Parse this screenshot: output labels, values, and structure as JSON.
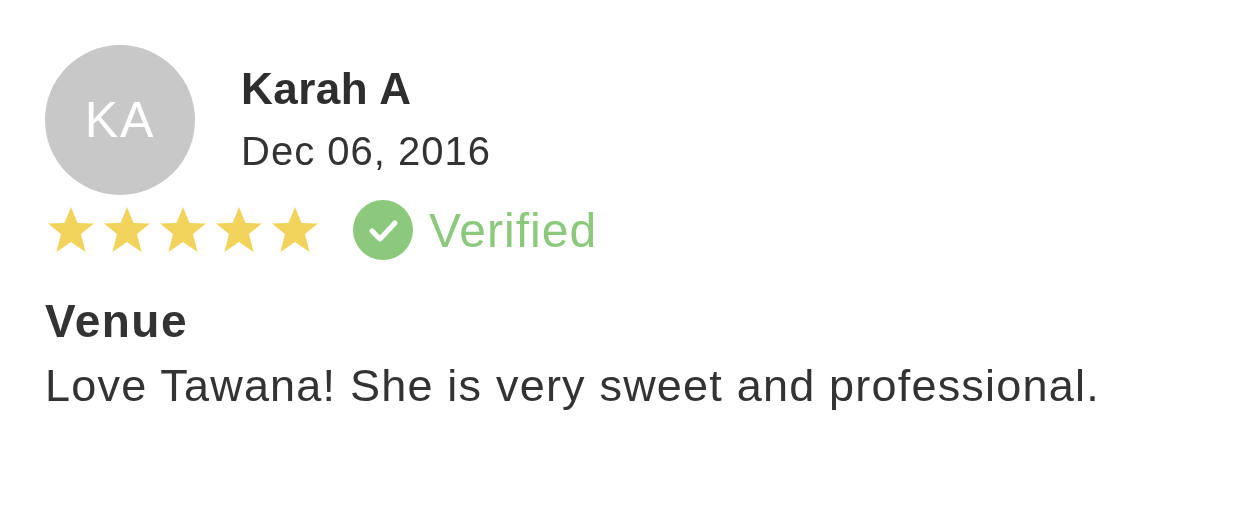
{
  "reviewer": {
    "initials": "KA",
    "name": "Karah A",
    "date": "Dec 06, 2016"
  },
  "rating": {
    "stars": 5,
    "verified": true,
    "verified_label": "Verified"
  },
  "review": {
    "category": "Venue",
    "text": "Love Tawana! She is very sweet and professional."
  }
}
